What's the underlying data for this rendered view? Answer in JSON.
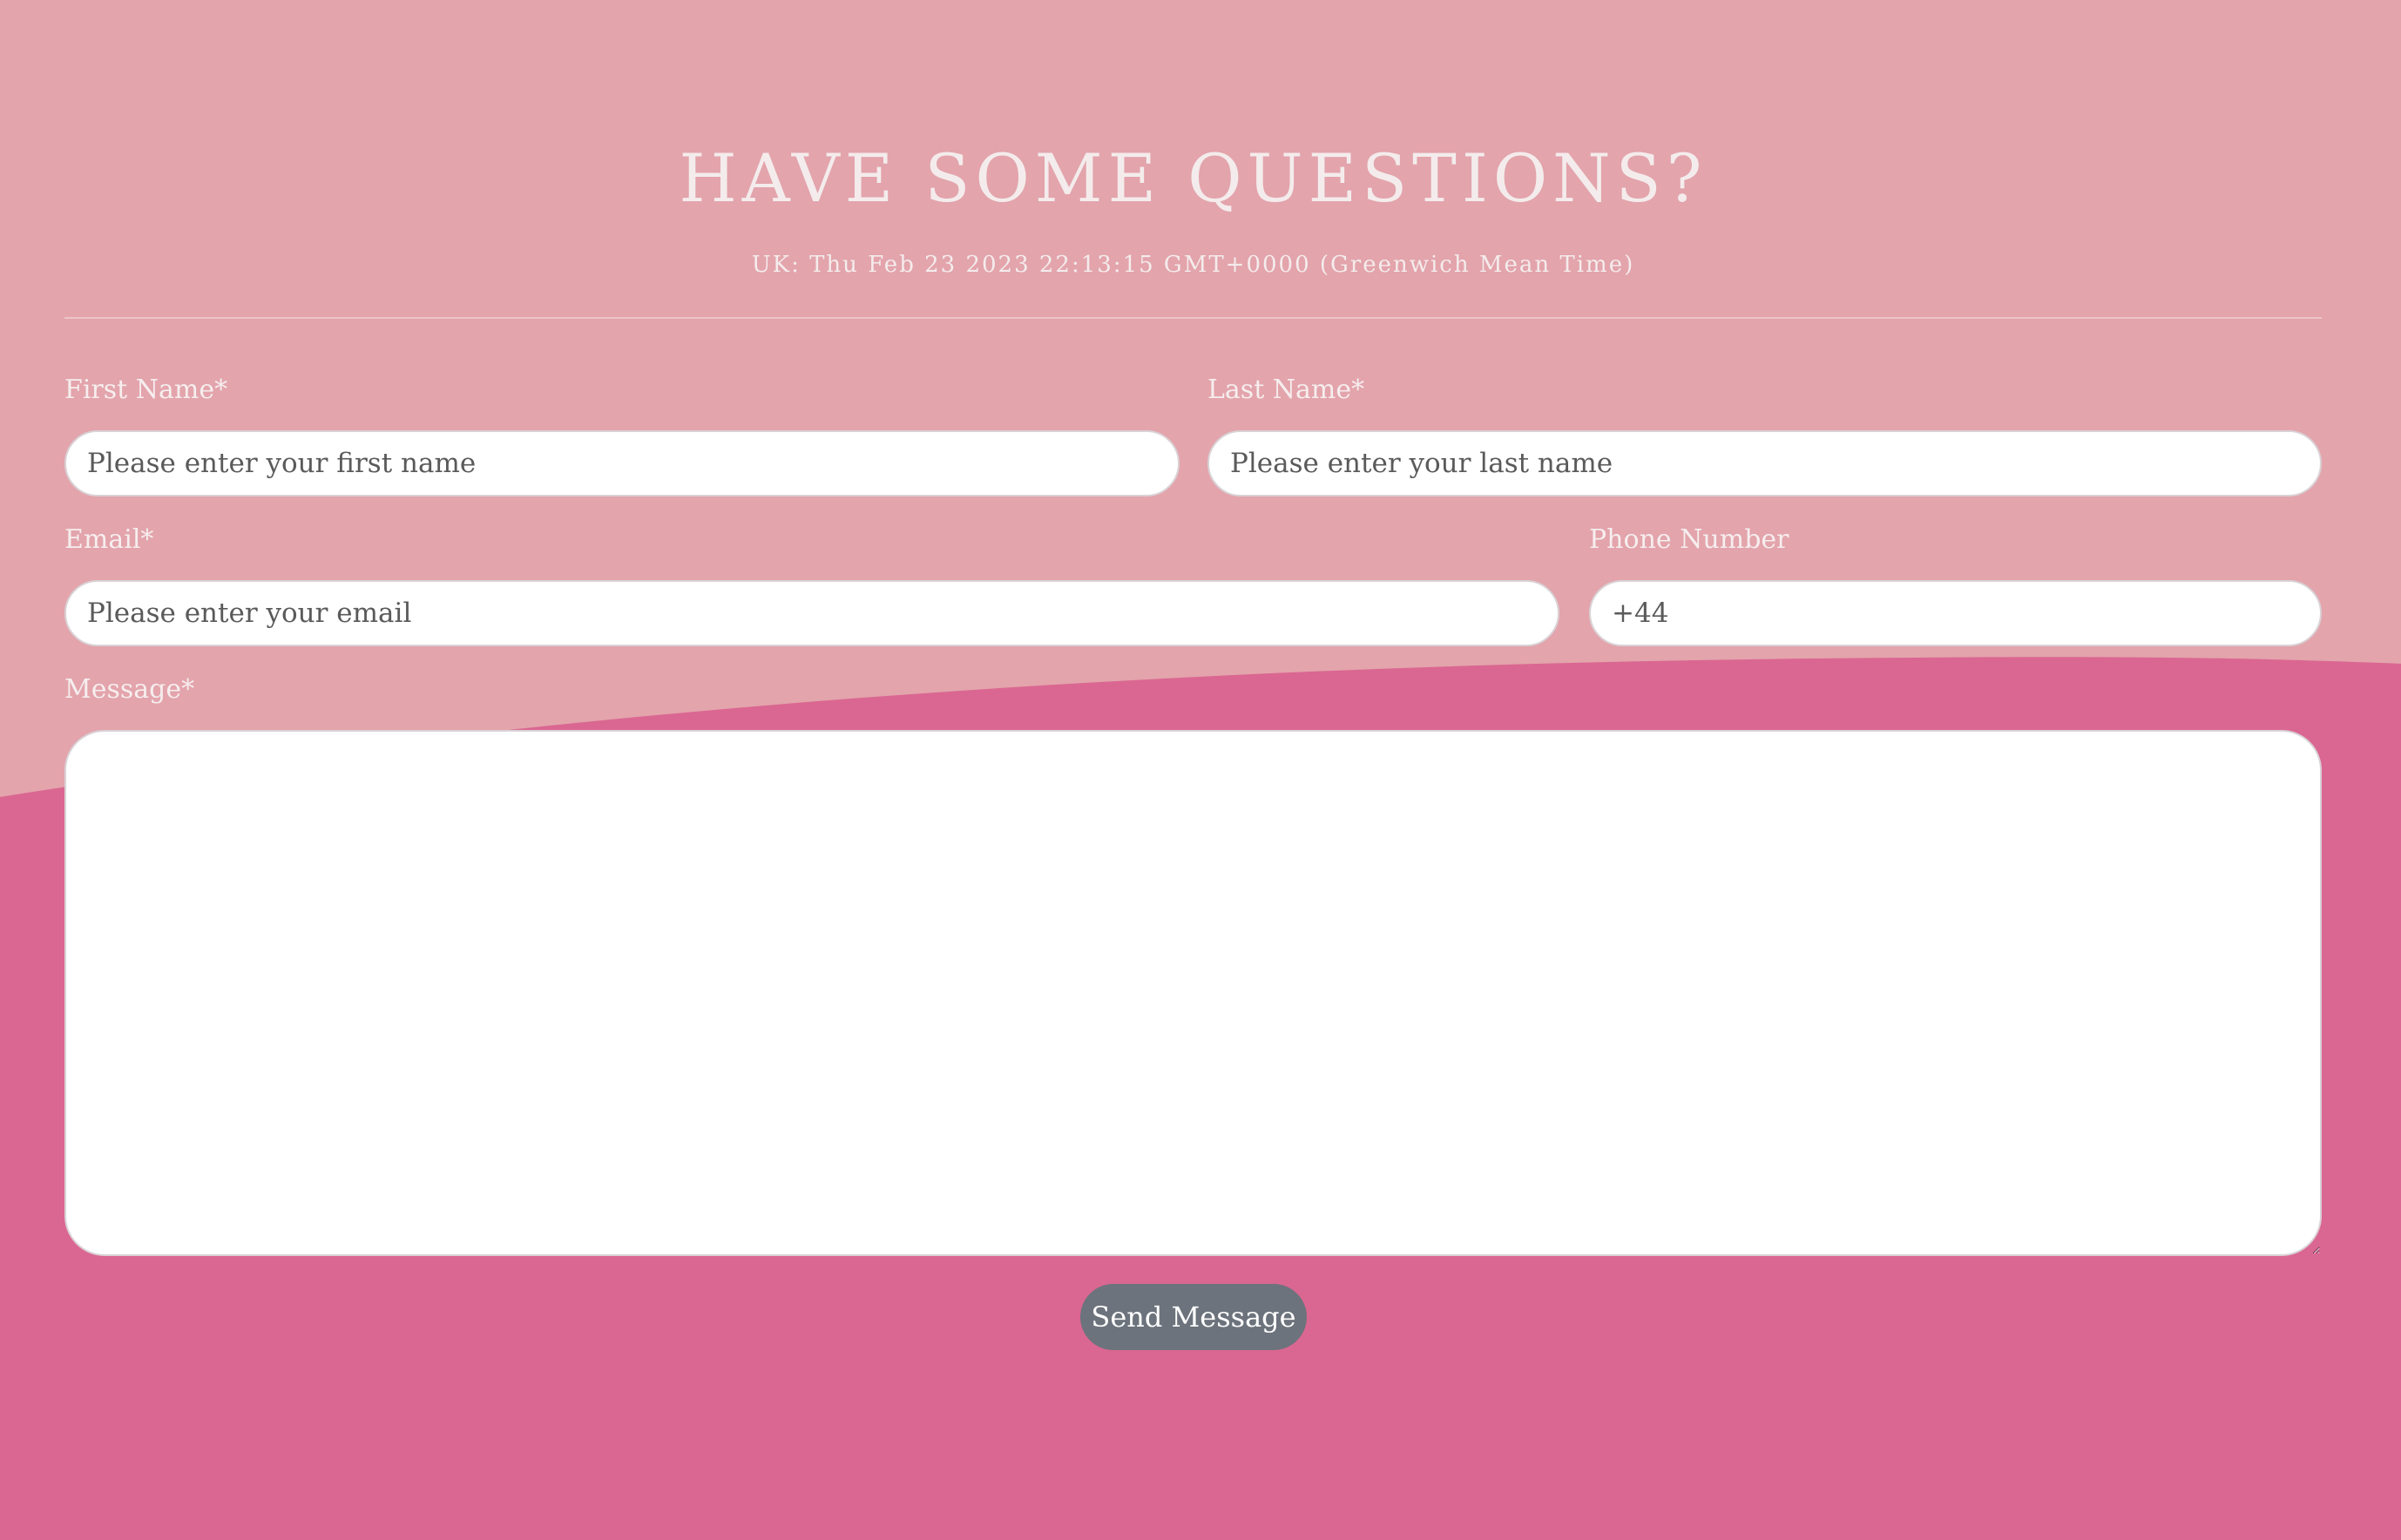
{
  "page": {
    "title": "HAVE SOME QUESTIONS?",
    "datetime": "UK: Thu Feb 23 2023 22:13:15 GMT+0000 (Greenwich Mean Time)"
  },
  "form": {
    "first_name": {
      "label": "First Name*",
      "placeholder": "Please enter your first name",
      "value": ""
    },
    "last_name": {
      "label": "Last Name*",
      "placeholder": "Please enter your last name",
      "value": ""
    },
    "email": {
      "label": "Email*",
      "placeholder": "Please enter your email",
      "value": ""
    },
    "phone": {
      "label": "Phone Number",
      "placeholder": "+44",
      "value": ""
    },
    "message": {
      "label": "Message*",
      "value": ""
    },
    "submit_label": "Send Message"
  },
  "colors": {
    "background_top": "#e3a4ac",
    "background_wave": "#da6791",
    "button": "#6c737c"
  }
}
